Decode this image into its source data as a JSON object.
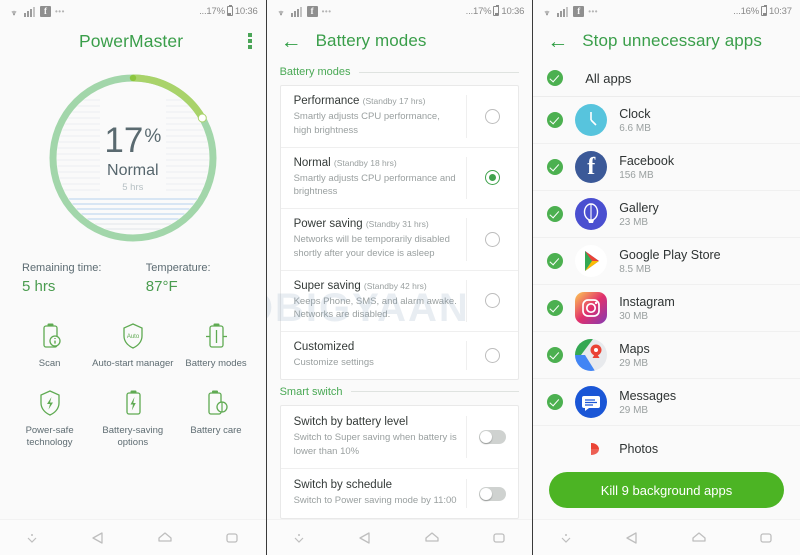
{
  "panel1": {
    "status": {
      "battery": "...17%",
      "time": "10:36",
      "icons": [
        "wifi-icon",
        "signal-icon",
        "facebook-icon",
        "overflow-icon"
      ]
    },
    "appbar": {
      "title": "PowerMaster",
      "menu_icon": "kebab-menu-icon"
    },
    "gauge": {
      "percent": "17",
      "percent_symbol": "%",
      "state": "Normal",
      "hours": "5 hrs",
      "value": 17,
      "arc_color": "#a9d36a",
      "track_color": "#a2d6aa"
    },
    "stats": [
      {
        "label": "Remaining time:",
        "value": "5 hrs"
      },
      {
        "label": "Temperature:",
        "value": "87°F"
      }
    ],
    "tools": [
      {
        "label": "Scan",
        "icon": "battery-scan-icon"
      },
      {
        "label": "Auto-start manager",
        "icon": "shield-auto-icon"
      },
      {
        "label": "Battery modes",
        "icon": "battery-modes-icon"
      },
      {
        "label": "Power-safe technology",
        "icon": "shield-bolt-icon"
      },
      {
        "label": "Battery-saving options",
        "icon": "battery-bolt-icon"
      },
      {
        "label": "Battery care",
        "icon": "battery-care-icon"
      }
    ]
  },
  "panel2": {
    "status": {
      "battery": "...17%",
      "time": "10:36"
    },
    "appbar": {
      "title": "Battery modes",
      "back_icon": "back-arrow-icon"
    },
    "sections": [
      {
        "title": "Battery modes"
      },
      {
        "title": "Smart switch"
      }
    ],
    "modes": [
      {
        "name": "Performance",
        "standby": "(Standby 17 hrs)",
        "desc": "Smartly adjusts CPU performance, high brightness",
        "selected": false
      },
      {
        "name": "Normal",
        "standby": "(Standby 18 hrs)",
        "desc": "Smartly adjusts CPU performance and brightness",
        "selected": true
      },
      {
        "name": "Power saving",
        "standby": "(Standby 31 hrs)",
        "desc": "Networks will be temporarily disabled shortly after your device is asleep",
        "selected": false
      },
      {
        "name": "Super saving",
        "standby": "(Standby 42 hrs)",
        "desc": "Keeps Phone, SMS, and alarm awake. Networks are disabled.",
        "selected": false
      },
      {
        "name": "Customized",
        "standby": "",
        "desc": "Customize settings",
        "selected": false
      }
    ],
    "smart_switches": [
      {
        "name": "Switch by battery level",
        "desc": "Switch to Super saving when battery is lower than 10%",
        "on": false
      },
      {
        "name": "Switch by schedule",
        "desc": "Switch to Power saving mode by 11:00",
        "on": false
      }
    ],
    "watermark": "MOBIGYAAN"
  },
  "panel3": {
    "status": {
      "battery": "...16%",
      "time": "10:37"
    },
    "appbar": {
      "title": "Stop unnecessary apps",
      "back_icon": "back-arrow-icon"
    },
    "all_apps": {
      "label": "All apps",
      "checked": true
    },
    "apps": [
      {
        "name": "Clock",
        "size": "6.6 MB",
        "checked": true,
        "icon": "clock-icon"
      },
      {
        "name": "Facebook",
        "size": "156 MB",
        "checked": true,
        "icon": "facebook-icon"
      },
      {
        "name": "Gallery",
        "size": "23 MB",
        "checked": true,
        "icon": "gallery-icon"
      },
      {
        "name": "Google Play Store",
        "size": "8.5 MB",
        "checked": true,
        "icon": "play-store-icon"
      },
      {
        "name": "Instagram",
        "size": "30 MB",
        "checked": true,
        "icon": "instagram-icon"
      },
      {
        "name": "Maps",
        "size": "29 MB",
        "checked": true,
        "icon": "maps-icon"
      },
      {
        "name": "Messages",
        "size": "29 MB",
        "checked": true,
        "icon": "messages-icon"
      },
      {
        "name": "Photos",
        "size": "",
        "checked": true,
        "icon": "photos-icon"
      }
    ],
    "kill_button": "Kill 9 background apps"
  },
  "navbar": {
    "items": [
      "hide-nav-icon",
      "back-icon",
      "home-icon",
      "recents-icon"
    ]
  },
  "colors": {
    "accent_green": "#3a9e4a",
    "button_green": "#4cb424",
    "check_green": "#4cb050"
  }
}
